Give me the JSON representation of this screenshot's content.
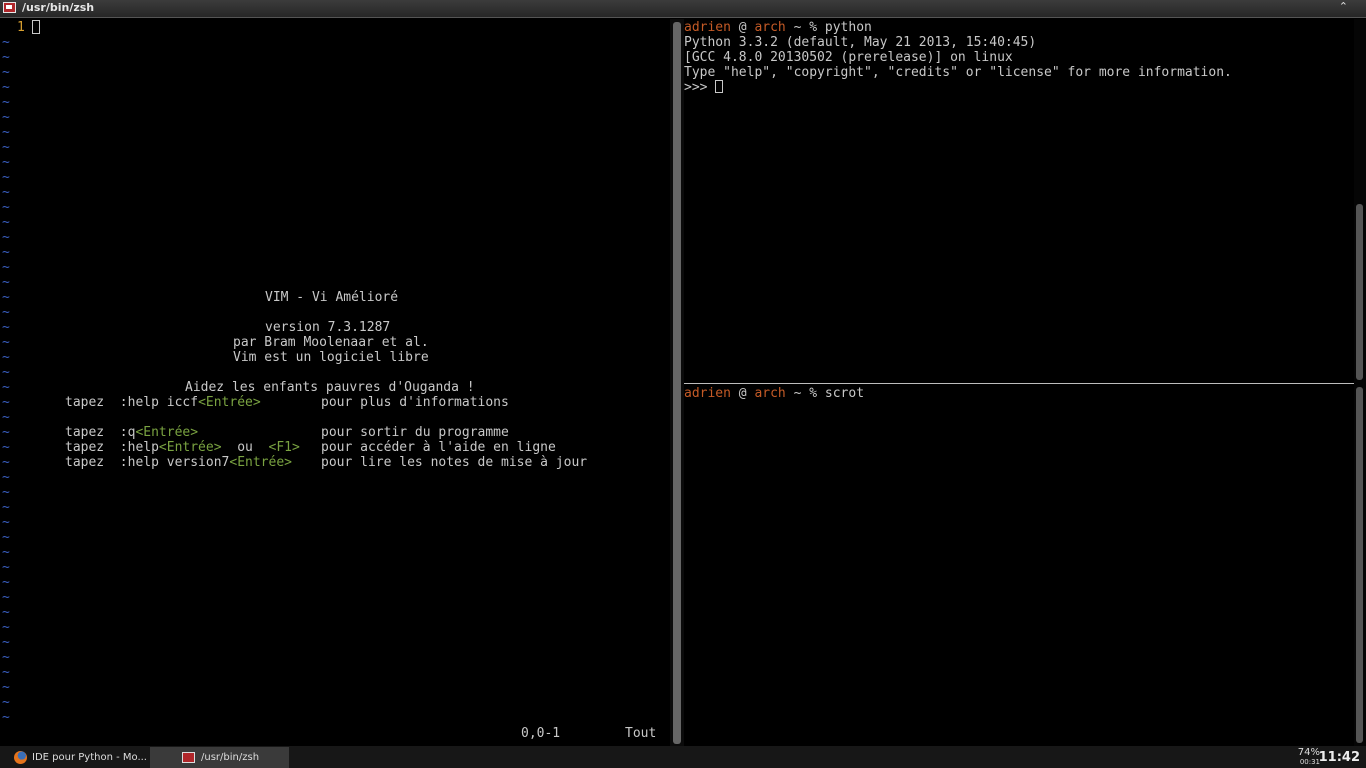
{
  "window": {
    "title": "/usr/bin/zsh"
  },
  "vim": {
    "line_number": "1",
    "tilde": "~",
    "intro": [
      "VIM - Vi Amélioré",
      "version 7.3.1287",
      "par Bram Moolenaar et al.",
      "Vim est un logiciel libre",
      "Aidez les enfants pauvres d'Ouganda !"
    ],
    "help_lines": [
      {
        "prefix": "tapez  :help iccf",
        "key": "<Entrée>",
        "mid": "",
        "key2": "",
        "desc": "pour plus d'informations"
      },
      {
        "prefix": "tapez  :q",
        "key": "<Entrée>",
        "mid": "",
        "key2": "",
        "desc": "pour sortir du programme"
      },
      {
        "prefix": "tapez  :help",
        "key": "<Entrée>",
        "mid": "  ou  ",
        "key2": "<F1>",
        "desc": "pour accéder à l'aide en ligne"
      },
      {
        "prefix": "tapez  :help version7",
        "key": "<Entrée>",
        "mid": "",
        "key2": "",
        "desc": "pour lire les notes de mise à jour"
      }
    ],
    "status_position": "0,0-1",
    "status_scroll": "Tout"
  },
  "python_pane": {
    "prompt_user": "adrien",
    "prompt_at": " @ ",
    "prompt_host": "arch",
    "prompt_rest": " ~ % ",
    "command": "python",
    "lines": [
      "Python 3.3.2 (default, May 21 2013, 15:40:45)",
      "[GCC 4.8.0 20130502 (prerelease)] on linux",
      "Type \"help\", \"copyright\", \"credits\" or \"license\" for more information."
    ],
    "repl_prompt": ">>> "
  },
  "shell_pane": {
    "prompt_user": "adrien",
    "prompt_at": " @ ",
    "prompt_host": "arch",
    "prompt_rest": " ~ % ",
    "command": "scrot"
  },
  "taskbar": {
    "tasks": [
      {
        "label": "IDE pour Python - Mo...",
        "icon": "firefox-icon"
      },
      {
        "label": "/usr/bin/zsh",
        "icon": "terminal-icon"
      }
    ],
    "battery_percent": "74%",
    "battery_remaining": "00:31",
    "clock": "11:42"
  }
}
